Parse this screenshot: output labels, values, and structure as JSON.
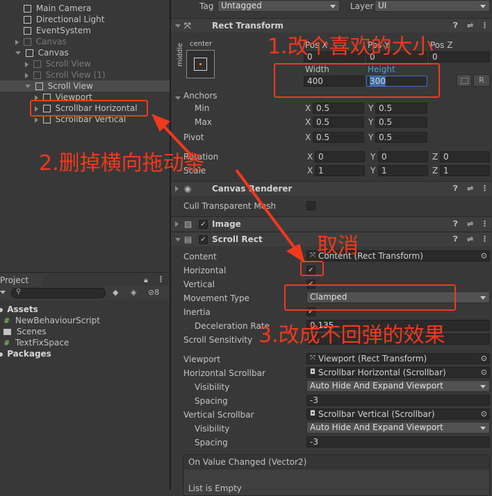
{
  "hierarchy": {
    "items": [
      {
        "label": "Main Camera",
        "dim": false
      },
      {
        "label": "Directional Light",
        "dim": false
      },
      {
        "label": "EventSystem",
        "dim": false
      },
      {
        "label": "Canvas",
        "dim": true
      },
      {
        "label": "Canvas",
        "dim": false
      },
      {
        "label": "Scroll View",
        "dim": true
      },
      {
        "label": "Scroll View (1)",
        "dim": true
      },
      {
        "label": "Scroll View",
        "dim": false
      },
      {
        "label": "Viewport",
        "dim": false
      },
      {
        "label": "Scrollbar Horizontal",
        "dim": false
      },
      {
        "label": "Scrollbar Vertical",
        "dim": false
      }
    ]
  },
  "project": {
    "tab_label": "Project",
    "hidden_count": "8",
    "items": [
      {
        "label": "Assets",
        "bold": true
      },
      {
        "label": "NewBehaviourScript",
        "bold": false
      },
      {
        "label": "Scenes",
        "bold": false
      },
      {
        "label": "TextFixSpace",
        "bold": false
      },
      {
        "label": "Packages",
        "bold": true
      }
    ]
  },
  "inspector": {
    "tag_label": "Tag",
    "tag_value": "Untagged",
    "layer_label": "Layer",
    "layer_value": "UI",
    "rect_transform": {
      "title": "Rect Transform",
      "anchor_preset_top": "center",
      "anchor_preset_side": "middle",
      "posx_label": "Pos X",
      "posy_label": "Pos Y",
      "posz_label": "Pos Z",
      "posx": "0",
      "posy": "0",
      "posz": "0",
      "width_label": "Width",
      "height_label": "Height",
      "width": "400",
      "height": "300",
      "r_button": "R",
      "anchors_label": "Anchors",
      "min_label": "Min",
      "max_label": "Max",
      "min_x": "0.5",
      "min_y": "0.5",
      "max_x": "0.5",
      "max_y": "0.5",
      "pivot_label": "Pivot",
      "pivot_x": "0.5",
      "pivot_y": "0.5",
      "rotation_label": "Rotation",
      "rot_x": "0",
      "rot_y": "0",
      "rot_z": "0",
      "scale_label": "Scale",
      "scale_x": "1",
      "scale_y": "1",
      "scale_z": "1",
      "x_label": "X",
      "y_label": "Y",
      "z_label": "Z"
    },
    "canvas_renderer": {
      "title": "Canvas Renderer",
      "cull_label": "Cull Transparent Mesh"
    },
    "image": {
      "title": "Image"
    },
    "scroll_rect": {
      "title": "Scroll Rect",
      "content_label": "Content",
      "content_value": "Content (Rect Transform)",
      "horizontal_label": "Horizontal",
      "vertical_label": "Vertical",
      "movement_label": "Movement Type",
      "movement_value": "Clamped",
      "inertia_label": "Inertia",
      "decel_label": "Deceleration Rate",
      "decel_value": "0.135",
      "sensitivity_label": "Scroll Sensitivity",
      "viewport_label": "Viewport",
      "viewport_value": "Viewport (Rect Transform)",
      "hscroll_label": "Horizontal Scrollbar",
      "hscroll_value": "Scrollbar Horizontal (Scrollbar)",
      "visibility_label": "Visibility",
      "h_visibility_value": "Auto Hide And Expand Viewport",
      "spacing_label": "Spacing",
      "h_spacing_value": "-3",
      "vscroll_label": "Vertical Scrollbar",
      "vscroll_value": "Scrollbar Vertical (Scrollbar)",
      "v_visibility_value": "Auto Hide And Expand Viewport",
      "v_spacing_value": "-3",
      "event_title": "On Value Changed (Vector2)",
      "event_empty": "List is Empty"
    }
  },
  "annotations": {
    "step1": "1.改个喜欢的大小",
    "step2": "2.删掉横向拖动条",
    "step3": "3.改成不回弹的效果",
    "cancel": "取消"
  },
  "colors": {
    "annotation_red": "#f2381d",
    "selection": "#4b4b4b",
    "panel_bg": "#383838",
    "field_bg": "#2a2a2a"
  }
}
